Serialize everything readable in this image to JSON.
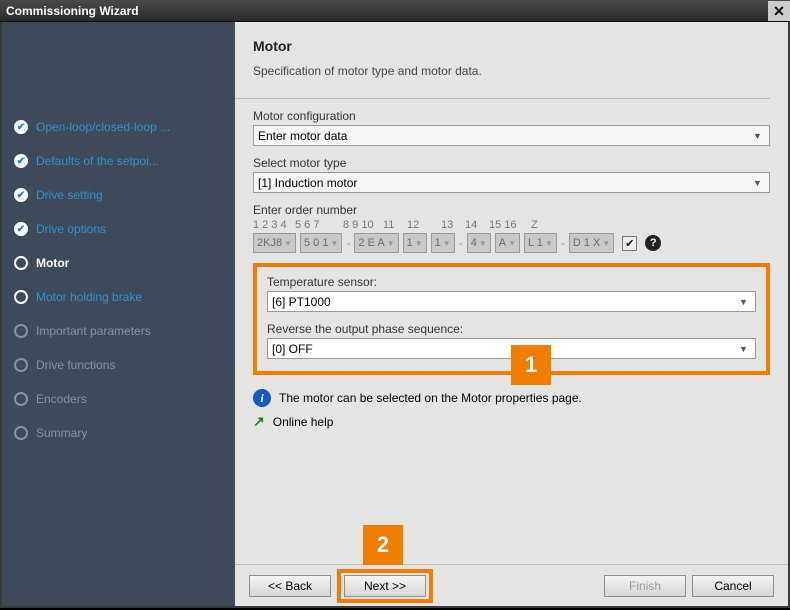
{
  "title": "Commissioning Wizard",
  "sidebar": {
    "steps": [
      {
        "label": "Open-loop/closed-loop ...",
        "state": "done"
      },
      {
        "label": "Defaults of the setpoi...",
        "state": "done"
      },
      {
        "label": "Drive setting",
        "state": "done"
      },
      {
        "label": "Drive options",
        "state": "done"
      },
      {
        "label": "Motor",
        "state": "current"
      },
      {
        "label": "Motor holding brake",
        "state": "pending"
      },
      {
        "label": "Important parameters",
        "state": "disabled"
      },
      {
        "label": "Drive functions",
        "state": "disabled"
      },
      {
        "label": "Encoders",
        "state": "disabled"
      },
      {
        "label": "Summary",
        "state": "disabled"
      }
    ]
  },
  "main": {
    "heading": "Motor",
    "subheading": "Specification of motor type and motor data.",
    "motor_config_label": "Motor configuration",
    "motor_config_value": "Enter motor data",
    "motor_type_label": "Select motor type",
    "motor_type_value": "[1] Induction motor",
    "order_label": "Enter order number",
    "order_headers": [
      "1 2 3 4",
      "5 6 7",
      "",
      "8 9 10",
      "11",
      "12",
      "",
      "13",
      "14",
      "15 16",
      "",
      "Z"
    ],
    "order_cells": [
      "2KJ8",
      "5 0 1",
      "-",
      "2 E A",
      "1",
      "1",
      "-",
      "4",
      "A",
      "L 1",
      "-",
      "D 1 X"
    ],
    "temp_label": "Temperature sensor:",
    "temp_value": "[6] PT1000",
    "reverse_label": "Reverse the output phase sequence:",
    "reverse_value": "[0] OFF",
    "info_text": "The motor can be selected on the Motor properties page.",
    "online_help": "Online help"
  },
  "callouts": {
    "one": "1",
    "two": "2"
  },
  "buttons": {
    "back": "<< Back",
    "next": "Next >>",
    "finish": "Finish",
    "cancel": "Cancel"
  }
}
